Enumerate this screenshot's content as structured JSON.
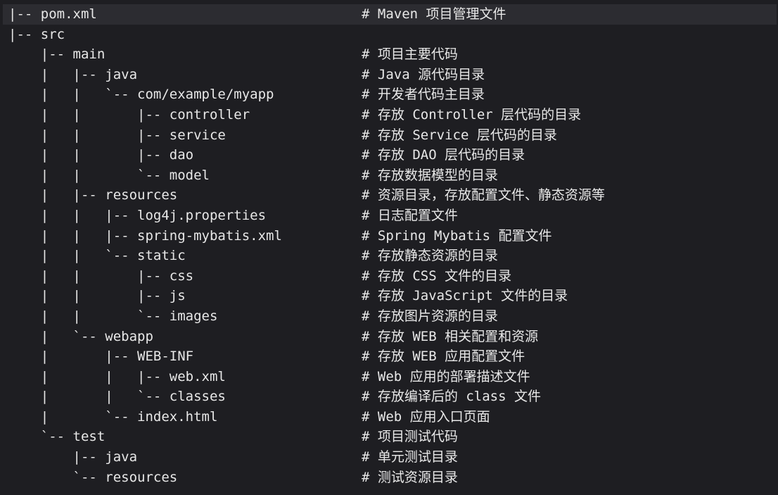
{
  "lines": [
    {
      "tree": "|-- pom.xml",
      "comment": "# Maven 项目管理文件"
    },
    {
      "tree": "|-- src",
      "comment": ""
    },
    {
      "tree": "    |-- main",
      "comment": "# 项目主要代码"
    },
    {
      "tree": "    |   |-- java",
      "comment": "# Java 源代码目录"
    },
    {
      "tree": "    |   |   `-- com/example/myapp",
      "comment": "# 开发者代码主目录"
    },
    {
      "tree": "    |   |       |-- controller",
      "comment": "# 存放 Controller 层代码的目录"
    },
    {
      "tree": "    |   |       |-- service",
      "comment": "# 存放 Service 层代码的目录"
    },
    {
      "tree": "    |   |       |-- dao",
      "comment": "# 存放 DAO 层代码的目录"
    },
    {
      "tree": "    |   |       `-- model",
      "comment": "# 存放数据模型的目录"
    },
    {
      "tree": "    |   |-- resources",
      "comment": "# 资源目录，存放配置文件、静态资源等"
    },
    {
      "tree": "    |   |   |-- log4j.properties",
      "comment": "# 日志配置文件"
    },
    {
      "tree": "    |   |   |-- spring-mybatis.xml",
      "comment": "# Spring Mybatis 配置文件"
    },
    {
      "tree": "    |   |   `-- static",
      "comment": "# 存放静态资源的目录"
    },
    {
      "tree": "    |   |       |-- css",
      "comment": "# 存放 CSS 文件的目录"
    },
    {
      "tree": "    |   |       |-- js",
      "comment": "# 存放 JavaScript 文件的目录"
    },
    {
      "tree": "    |   |       `-- images",
      "comment": "# 存放图片资源的目录"
    },
    {
      "tree": "    |   `-- webapp",
      "comment": "# 存放 WEB 相关配置和资源"
    },
    {
      "tree": "    |       |-- WEB-INF",
      "comment": "# 存放 WEB 应用配置文件"
    },
    {
      "tree": "    |       |   |-- web.xml",
      "comment": "# Web 应用的部署描述文件"
    },
    {
      "tree": "    |       |   `-- classes",
      "comment": "# 存放编译后的 class 文件"
    },
    {
      "tree": "    |       `-- index.html",
      "comment": "# Web 应用入口页面"
    },
    {
      "tree": "    `-- test",
      "comment": "# 项目测试代码"
    },
    {
      "tree": "        |-- java",
      "comment": "# 单元测试目录"
    },
    {
      "tree": "        `-- resources",
      "comment": "# 测试资源目录"
    }
  ],
  "colors": {
    "background": "#1e1e22",
    "highlight": "#2c2c31",
    "text": "#e8e8e8"
  }
}
